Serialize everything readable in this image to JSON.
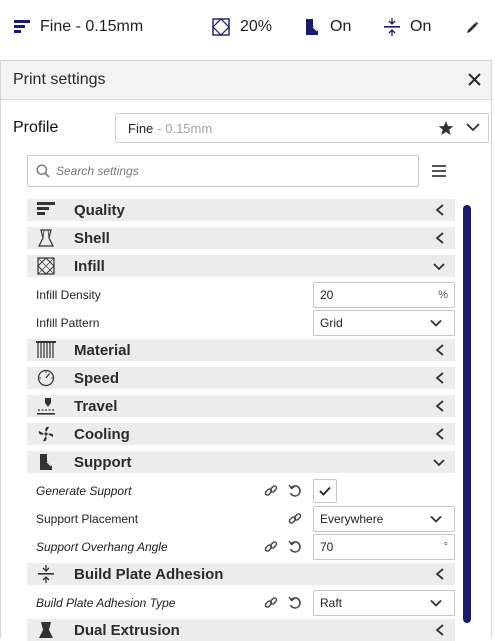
{
  "topbar": {
    "quality": "Fine - 0.15mm",
    "infill": "20%",
    "support": "On",
    "adhesion": "On"
  },
  "panel": {
    "title": "Print settings",
    "profile_label": "Profile",
    "profile_name": "Fine",
    "profile_detail": "- 0.15mm",
    "search_placeholder": "Search settings"
  },
  "categories": {
    "quality": "Quality",
    "shell": "Shell",
    "infill": "Infill",
    "material": "Material",
    "speed": "Speed",
    "travel": "Travel",
    "cooling": "Cooling",
    "support": "Support",
    "adhesion": "Build Plate Adhesion",
    "dual": "Dual Extrusion"
  },
  "settings": {
    "infill_density": {
      "label": "Infill Density",
      "value": "20",
      "unit": "%"
    },
    "infill_pattern": {
      "label": "Infill Pattern",
      "value": "Grid"
    },
    "generate_support": {
      "label": "Generate Support",
      "checked": true
    },
    "support_placement": {
      "label": "Support Placement",
      "value": "Everywhere"
    },
    "support_overhang": {
      "label": "Support Overhang Angle",
      "value": "70",
      "unit": "°"
    },
    "adhesion_type": {
      "label": "Build Plate Adhesion Type",
      "value": "Raft"
    }
  },
  "colors": {
    "accent": "#1a1a6e",
    "category_bg": "#ececec",
    "header_bg": "#f3f3f3"
  }
}
